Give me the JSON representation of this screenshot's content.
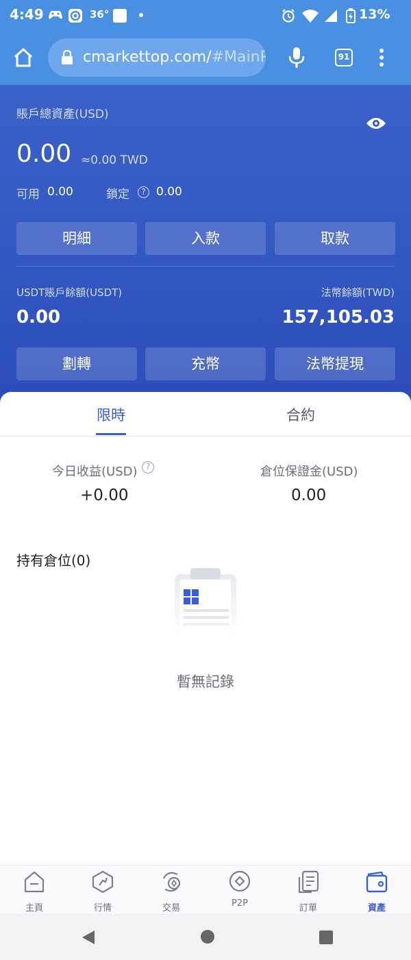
{
  "status_bar": {
    "time": "4:49",
    "temperature": "36°",
    "battery": "13%"
  },
  "browser": {
    "url_main": "cmarkettop.com/",
    "url_fragment": "#MainP",
    "tab_count": "91"
  },
  "account": {
    "total_label": "賬戶總資產(USD)",
    "total_value": "0.00",
    "approx_value": "≈0.00 TWD",
    "available_label": "可用",
    "available_value": "0.00",
    "locked_label": "鎖定",
    "locked_value": "0.00",
    "buttons": [
      "明細",
      "入款",
      "取款"
    ],
    "usdt_label": "USDT賬戶餘額(USDT)",
    "usdt_value": "0.00",
    "fiat_label": "法幣餘額(TWD)",
    "fiat_value": "157,105.03",
    "buttons2": [
      "劃轉",
      "充幣",
      "法幣提現"
    ]
  },
  "tabs": {
    "active": "限時",
    "inactive": "合約"
  },
  "stats": {
    "today_profit_label": "今日收益(USD)",
    "today_profit_value": "+0.00",
    "margin_label": "倉位保證金(USD)",
    "margin_value": "0.00"
  },
  "positions": {
    "title": "持有倉位(0)",
    "empty_text": "暫無記錄"
  },
  "bottom_nav": [
    "主頁",
    "行情",
    "交易",
    "P2P",
    "訂單",
    "資產"
  ],
  "colors": {
    "browser_blue": "#4a90e2",
    "panel_blue": "#2c4db9",
    "accent": "#3a5fcd"
  }
}
